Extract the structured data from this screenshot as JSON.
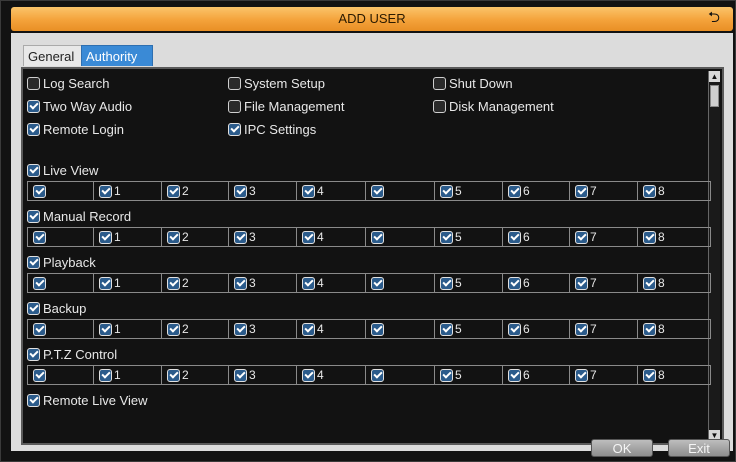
{
  "window": {
    "title": "ADD USER"
  },
  "tabs": [
    {
      "label": "General",
      "active": false
    },
    {
      "label": "Authority",
      "active": true
    }
  ],
  "permissions": [
    {
      "label": "Log Search",
      "checked": false
    },
    {
      "label": "System Setup",
      "checked": false
    },
    {
      "label": "Shut Down",
      "checked": false
    },
    {
      "label": "Two Way Audio",
      "checked": true
    },
    {
      "label": "File Management",
      "checked": false
    },
    {
      "label": "Disk Management",
      "checked": false
    },
    {
      "label": "Remote Login",
      "checked": true
    },
    {
      "label": "IPC Settings",
      "checked": true
    }
  ],
  "channel_groups": [
    {
      "label": "Live View",
      "checked": true
    },
    {
      "label": "Manual Record",
      "checked": true
    },
    {
      "label": "Playback",
      "checked": true
    },
    {
      "label": "Backup",
      "checked": true
    },
    {
      "label": "P.T.Z Control",
      "checked": true
    },
    {
      "label": "Remote Live View",
      "checked": true
    }
  ],
  "channels": [
    "",
    "1",
    "2",
    "3",
    "4",
    "",
    "5",
    "6",
    "7",
    "8"
  ],
  "buttons": {
    "ok": "OK",
    "exit": "Exit"
  },
  "icons": {
    "back": "back-arrow-icon",
    "checkbox": "checkbox-icon",
    "scroll_up": "scroll-up-icon",
    "scroll_down": "scroll-down-icon"
  },
  "colors": {
    "title_bar": "#f4a23a",
    "active_tab": "#3a8ad6",
    "background": "#121212"
  }
}
